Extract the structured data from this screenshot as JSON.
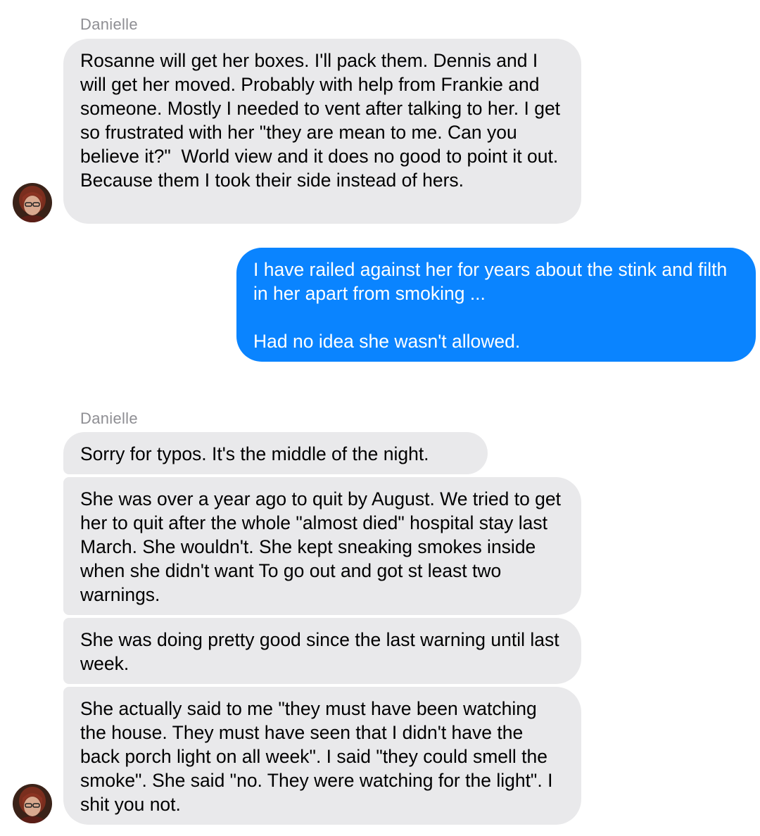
{
  "thread": {
    "group1": {
      "sender": "Danielle",
      "messages": [
        "Rosanne will get her boxes. I'll pack them. Dennis and I will get her moved. Probably with help from Frankie and someone. Mostly I needed to vent after talking to her. I get so frustrated with her \"they are mean to me. Can you believe it?\"  World view and it does no good to point it out. Because them I took their side instead of hers."
      ]
    },
    "outgoing": {
      "text": "I have railed against her for years about the stink and filth in her apart from smoking ...\n\nHad no idea she wasn't allowed."
    },
    "group2": {
      "sender": "Danielle",
      "messages": [
        "Sorry for typos. It's the middle of the night.",
        "She was over a year ago to quit by August. We tried to get her to quit after the whole \"almost died\" hospital stay last March. She wouldn't. She kept sneaking smokes inside when she didn't want To go out and got st least two warnings.",
        "She was doing pretty good since the last warning until last week.",
        "She actually said to me \"they must have been watching the house. They must have seen that I didn't have the back porch light on all week\". I said \"they could smell the smoke\". She said \"no. They were watching for the light\". I shit you not."
      ]
    }
  },
  "colors": {
    "incoming_bubble": "#e9e9eb",
    "outgoing_bubble": "#0a84ff",
    "sender_label": "#8e8e93"
  },
  "icons": {
    "avatar": "contact-avatar-photo"
  }
}
